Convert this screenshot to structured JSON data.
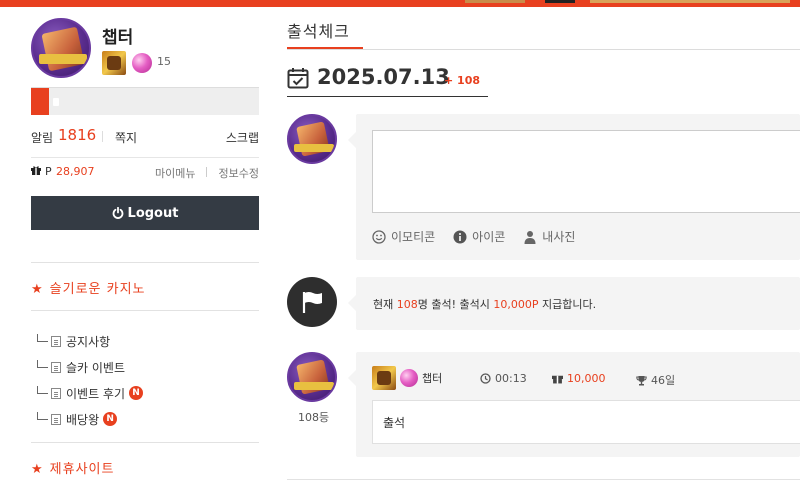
{
  "sidebar": {
    "username": "챕터",
    "level": "15",
    "exp_progress": 0.08,
    "alarm_label": "알림",
    "alarm_count": "1816",
    "memo_label": "쪽지",
    "scrap_label": "스크랩",
    "points_label": "P",
    "points_value": "28,907",
    "mymenu_label": "마이메뉴",
    "edit_label": "정보수정",
    "logout_label": "Logout",
    "section1_title": "슬기로운 카지노",
    "menu_items": [
      {
        "label": "공지사항",
        "new": ""
      },
      {
        "label": "슬카 이벤트",
        "new": ""
      },
      {
        "label": "이벤트 후기",
        "new": "N"
      },
      {
        "label": "배당왕",
        "new": "N"
      }
    ],
    "section2_title": "제휴사이트",
    "star_glyph": "★"
  },
  "main": {
    "header": "출석체크",
    "date": "2025.07.13",
    "date_count": "+ 108",
    "tools": [
      {
        "icon": "smile-icon",
        "label": "이모티콘"
      },
      {
        "icon": "info-icon",
        "label": "아이콘"
      },
      {
        "icon": "user-icon",
        "label": "내사진"
      }
    ],
    "notice": {
      "prefix": "현재 ",
      "count": "108",
      "mid": "명 출석! 출석시 ",
      "reward": "10,000P",
      "suffix": " 지급합니다."
    },
    "entry": {
      "name": "챕터",
      "time": "00:13",
      "points": "10,000",
      "streak": "46일",
      "body": "출석",
      "rank": "108등"
    }
  },
  "colors": {
    "accent": "#e8401f",
    "dark_button": "#343b44",
    "card_bg": "#f4f4f4"
  }
}
